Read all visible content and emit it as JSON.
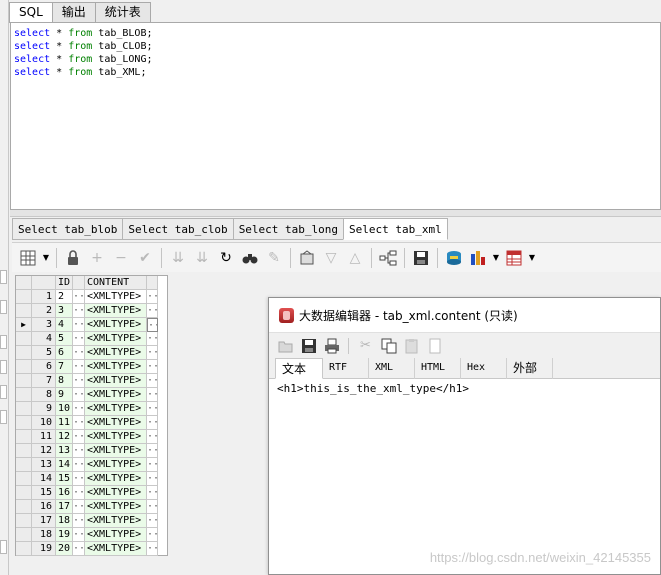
{
  "top_tabs": [
    "SQL",
    "输出",
    "统计表"
  ],
  "sql_lines": [
    {
      "kw1": "select",
      "star": " * ",
      "kw2": "from",
      "rest": " tab_BLOB;"
    },
    {
      "kw1": "select",
      "star": " * ",
      "kw2": "from",
      "rest": " tab_CLOB;"
    },
    {
      "kw1": "select",
      "star": " * ",
      "kw2": "from",
      "rest": " tab_LONG;"
    },
    {
      "kw1": "select",
      "star": " * ",
      "kw2": "from",
      "rest": " tab_XML;"
    }
  ],
  "result_tabs": [
    "Select tab_blob",
    "Select tab_clob",
    "Select tab_long",
    "Select tab_xml"
  ],
  "grid": {
    "headers": {
      "id": "ID",
      "content": "CONTENT"
    },
    "ellipsis": "···",
    "current_marker": "▶",
    "rows": [
      {
        "num": "1",
        "id": "2",
        "content": "<XMLTYPE>"
      },
      {
        "num": "2",
        "id": "3",
        "content": "<XMLTYPE>"
      },
      {
        "num": "3",
        "id": "4",
        "content": "<XMLTYPE>"
      },
      {
        "num": "4",
        "id": "5",
        "content": "<XMLTYPE>"
      },
      {
        "num": "5",
        "id": "6",
        "content": "<XMLTYPE>"
      },
      {
        "num": "6",
        "id": "7",
        "content": "<XMLTYPE>"
      },
      {
        "num": "7",
        "id": "8",
        "content": "<XMLTYPE>"
      },
      {
        "num": "8",
        "id": "9",
        "content": "<XMLTYPE>"
      },
      {
        "num": "9",
        "id": "10",
        "content": "<XMLTYPE>"
      },
      {
        "num": "10",
        "id": "11",
        "content": "<XMLTYPE>"
      },
      {
        "num": "11",
        "id": "12",
        "content": "<XMLTYPE>"
      },
      {
        "num": "12",
        "id": "13",
        "content": "<XMLTYPE>"
      },
      {
        "num": "13",
        "id": "14",
        "content": "<XMLTYPE>"
      },
      {
        "num": "14",
        "id": "15",
        "content": "<XMLTYPE>"
      },
      {
        "num": "15",
        "id": "16",
        "content": "<XMLTYPE>"
      },
      {
        "num": "16",
        "id": "17",
        "content": "<XMLTYPE>"
      },
      {
        "num": "17",
        "id": "18",
        "content": "<XMLTYPE>"
      },
      {
        "num": "18",
        "id": "19",
        "content": "<XMLTYPE>"
      },
      {
        "num": "19",
        "id": "20",
        "content": "<XMLTYPE>"
      }
    ]
  },
  "editor": {
    "title": "大数据编辑器 - tab_xml.content (只读)",
    "tabs": [
      "文本",
      "RTF",
      "XML",
      "HTML",
      "Hex",
      "外部"
    ],
    "content": "<h1>this_is_the_xml_type</h1>"
  },
  "watermark": "https://blog.csdn.net/weixin_42145355",
  "colors": {
    "keyword": "#0000ff",
    "from_keyword": "#008000",
    "changed_row": "#eafbe8"
  }
}
